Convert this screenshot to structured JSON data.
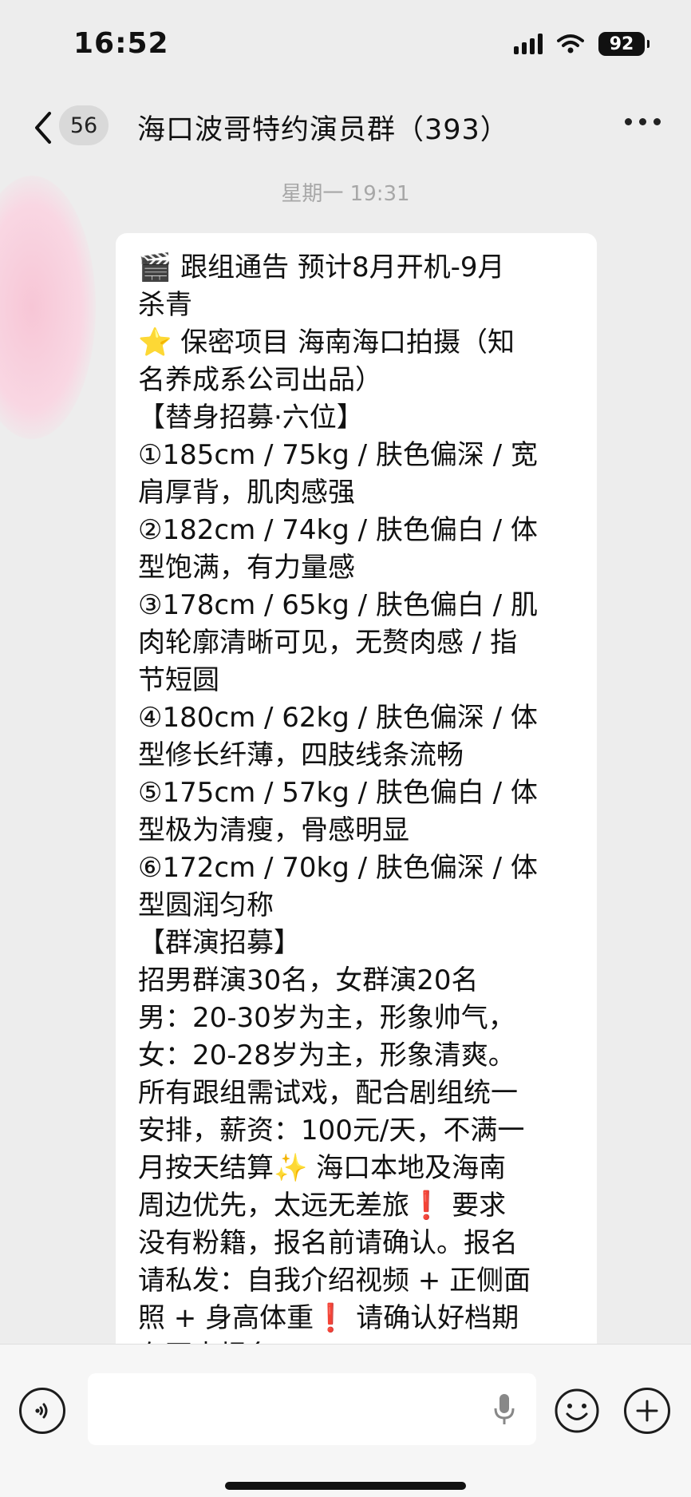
{
  "status_bar": {
    "time": "16:52",
    "battery": "92"
  },
  "nav": {
    "unread_count": "56",
    "title": "海口波哥特约演员群（393）"
  },
  "timestamp": "星期一 19:31",
  "message": {
    "lines": [
      "🎬 跟组通告 预计8月开机-9月",
      "杀青",
      "⭐ 保密项目 海南海口拍摄（知",
      "名养成系公司出品）",
      "【替身招募·六位】",
      "①185cm / 75kg / 肤色偏深 / 宽",
      "肩厚背，肌肉感强",
      "②182cm / 74kg / 肤色偏白 / 体",
      "型饱满，有力量感",
      "③178cm / 65kg / 肤色偏白 / 肌",
      "肉轮廓清晰可见，无赘肉感 / 指",
      "节短圆",
      "④180cm / 62kg / 肤色偏深 / 体",
      "型修长纤薄，四肢线条流畅",
      "⑤175cm / 57kg / 肤色偏白 / 体",
      "型极为清瘦，骨感明显",
      "⑥172cm / 70kg / 肤色偏深 / 体",
      "型圆润匀称",
      "【群演招募】",
      "招男群演30名，女群演20名",
      "男：20-30岁为主，形象帅气，",
      "女：20-28岁为主，形象清爽。",
      "所有跟组需试戏，配合剧组统一",
      "安排，薪资：100元/天，不满一",
      "月按天结算✨ 海口本地及海南",
      "周边优先，太远无差旅❗ 要求",
      "没有粉籍，报名前请确认。报名",
      "请私发：自我介绍视频 + 正侧面",
      "照 + 身高体重❗ 请确认好档期",
      "在再来报名"
    ]
  },
  "icons": {
    "back": "chevron-left-icon",
    "more": "more-dots-icon",
    "voice": "voice-icon",
    "mic": "mic-icon",
    "emoji": "emoji-icon",
    "plus": "plus-icon"
  }
}
